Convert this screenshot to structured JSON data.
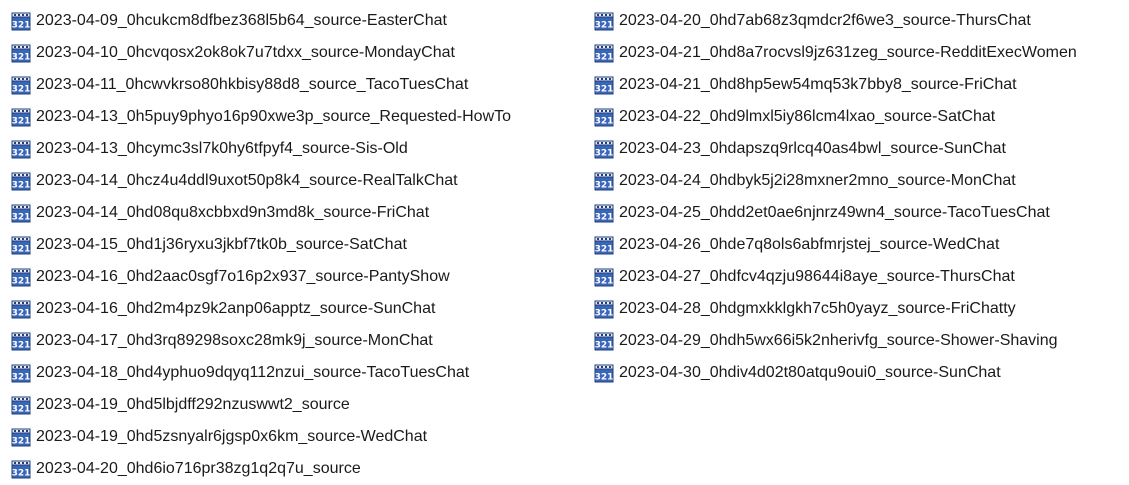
{
  "icon": "media-player-classic-file-icon",
  "colors": {
    "icon_film_blue": "#3a66b8",
    "icon_number_text": "#ffffff",
    "text": "#1a1a1a",
    "background": "#ffffff"
  },
  "files_left": [
    "2023-04-09_0hcukcm8dfbez368l5b64_source-EasterChat",
    "2023-04-10_0hcvqosx2ok8ok7u7tdxx_source-MondayChat",
    "2023-04-11_0hcwvkrso80hkbisy88d8_source_TacoTuesChat",
    "2023-04-13_0h5puy9phyo16p90xwe3p_source_Requested-HowTo",
    "2023-04-13_0hcymc3sl7k0hy6tfpyf4_source-Sis-Old",
    "2023-04-14_0hcz4u4ddl9uxot50p8k4_source-RealTalkChat",
    "2023-04-14_0hd08qu8xcbbxd9n3md8k_source-FriChat",
    "2023-04-15_0hd1j36ryxu3jkbf7tk0b_source-SatChat",
    "2023-04-16_0hd2aac0sgf7o16p2x937_source-PantyShow",
    "2023-04-16_0hd2m4pz9k2anp06apptz_source-SunChat",
    "2023-04-17_0hd3rq89298soxc28mk9j_source-MonChat",
    "2023-04-18_0hd4yphuo9dqyq112nzui_source-TacoTuesChat",
    "2023-04-19_0hd5lbjdff292nzuswwt2_source",
    "2023-04-19_0hd5zsnyalr6jgsp0x6km_source-WedChat",
    "2023-04-20_0hd6io716pr38zg1q2q7u_source"
  ],
  "files_right": [
    "2023-04-20_0hd7ab68z3qmdcr2f6we3_source-ThursChat",
    "2023-04-21_0hd8a7rocvsl9jz631zeg_source-RedditExecWomen",
    "2023-04-21_0hd8hp5ew54mq53k7bby8_source-FriChat",
    "2023-04-22_0hd9lmxl5iy86lcm4lxao_source-SatChat",
    "2023-04-23_0hdapszq9rlcq40as4bwl_source-SunChat",
    "2023-04-24_0hdbyk5j2i28mxner2mno_source-MonChat",
    "2023-04-25_0hdd2et0ae6njnrz49wn4_source-TacoTuesChat",
    "2023-04-26_0hde7q8ols6abfmrjstej_source-WedChat",
    "2023-04-27_0hdfcv4qzju98644i8aye_source-ThursChat",
    "2023-04-28_0hdgmxkklgkh7c5h0yayz_source-FriChatty",
    "2023-04-29_0hdh5wx66i5k2nherivfg_source-Shower-Shaving",
    "2023-04-30_0hdiv4d02t80atqu9oui0_source-SunChat"
  ]
}
